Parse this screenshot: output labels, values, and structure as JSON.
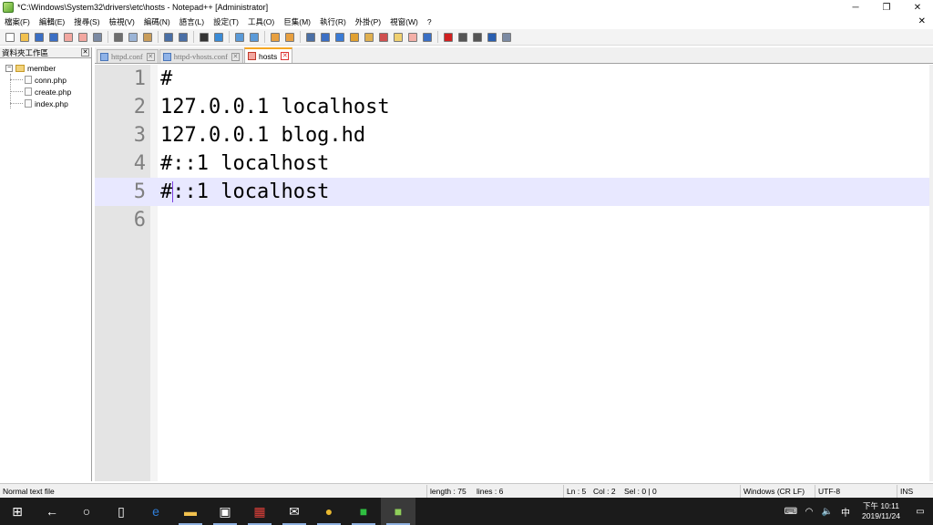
{
  "window": {
    "title": "*C:\\Windows\\System32\\drivers\\etc\\hosts - Notepad++ [Administrator]",
    "minimize": "─",
    "maximize": "❐",
    "close": "✕"
  },
  "menu": {
    "items": [
      "檔案(F)",
      "編輯(E)",
      "搜尋(S)",
      "檢視(V)",
      "編碼(N)",
      "語言(L)",
      "設定(T)",
      "工具(O)",
      "巨集(M)",
      "執行(R)",
      "外掛(P)",
      "視窗(W)",
      "?"
    ],
    "close": "✕"
  },
  "toolbar": {
    "icons": [
      {
        "name": "new-file-icon",
        "color": "#ffffff"
      },
      {
        "name": "open-file-icon",
        "color": "#f2c14e"
      },
      {
        "name": "save-icon",
        "color": "#3b6fc4"
      },
      {
        "name": "save-all-icon",
        "color": "#3b6fc4"
      },
      {
        "name": "close-icon",
        "color": "#f2a7a0"
      },
      {
        "name": "close-all-icon",
        "color": "#f2a7a0"
      },
      {
        "name": "print-icon",
        "color": "#7b8aa3"
      },
      {
        "name": "sep"
      },
      {
        "name": "cut-icon",
        "color": "#6e6e6e"
      },
      {
        "name": "copy-icon",
        "color": "#9bb4d6"
      },
      {
        "name": "paste-icon",
        "color": "#c99d5b"
      },
      {
        "name": "sep"
      },
      {
        "name": "undo-icon",
        "color": "#4a6fa5"
      },
      {
        "name": "redo-icon",
        "color": "#4a6fa5"
      },
      {
        "name": "sep"
      },
      {
        "name": "find-icon",
        "color": "#333333"
      },
      {
        "name": "replace-icon",
        "color": "#3a8bd6"
      },
      {
        "name": "sep"
      },
      {
        "name": "zoom-in-icon",
        "color": "#5a9ad8"
      },
      {
        "name": "zoom-out-icon",
        "color": "#5a9ad8"
      },
      {
        "name": "sep"
      },
      {
        "name": "sync-vertical-icon",
        "color": "#e8a040"
      },
      {
        "name": "sync-horizontal-icon",
        "color": "#e8a040"
      },
      {
        "name": "sep"
      },
      {
        "name": "word-wrap-icon",
        "color": "#4a6fa5"
      },
      {
        "name": "show-all-chars-icon",
        "color": "#3b6fc4"
      },
      {
        "name": "indent-guide-icon",
        "color": "#3a7bd5"
      },
      {
        "name": "udl-icon",
        "color": "#e0a030"
      },
      {
        "name": "doc-map-icon",
        "color": "#e0b050"
      },
      {
        "name": "function-list-icon",
        "color": "#d05050"
      },
      {
        "name": "folder-as-workspace-icon",
        "color": "#f0d070"
      },
      {
        "name": "doc-list-icon",
        "color": "#f4b0a8"
      },
      {
        "name": "monitoring-icon",
        "color": "#3a6fc4"
      },
      {
        "name": "sep"
      },
      {
        "name": "record-macro-icon",
        "color": "#d02020"
      },
      {
        "name": "stop-macro-icon",
        "color": "#555555"
      },
      {
        "name": "play-macro-icon",
        "color": "#555555"
      },
      {
        "name": "run-macro-multiple-icon",
        "color": "#2a5fb0"
      },
      {
        "name": "save-macro-icon",
        "color": "#7b8aa3"
      }
    ]
  },
  "folder_panel": {
    "title": "資料夾工作區",
    "close": "✕",
    "root": {
      "expander": "−",
      "name": "member"
    },
    "files": [
      "conn.php",
      "create.php",
      "index.php"
    ]
  },
  "tabs": [
    {
      "label": "httpd.conf",
      "close": "✕",
      "active": false
    },
    {
      "label": "httpd-vhosts.conf",
      "close": "✕",
      "active": false
    },
    {
      "label": "hosts",
      "close": "✕",
      "active": true
    }
  ],
  "editor": {
    "lines": [
      {
        "num": "1",
        "text": "#"
      },
      {
        "num": "2",
        "text": "127.0.0.1 localhost"
      },
      {
        "num": "3",
        "text": "127.0.0.1 blog.hd"
      },
      {
        "num": "4",
        "text": "#::1 localhost"
      },
      {
        "num": "5",
        "text": "#::1 localhost",
        "current": true
      },
      {
        "num": "6",
        "text": ""
      }
    ]
  },
  "status": {
    "file_type": "Normal text file",
    "length": "length : 75",
    "lines": "lines : 6",
    "ln": "Ln : 5",
    "col": "Col : 2",
    "sel": "Sel : 0 | 0",
    "eol": "Windows (CR LF)",
    "encoding": "UTF-8",
    "mode": "INS"
  },
  "taskbar": {
    "apps": [
      {
        "name": "start-icon",
        "glyph": "⊞"
      },
      {
        "name": "back-icon",
        "glyph": "←"
      },
      {
        "name": "search-icon",
        "glyph": "○"
      },
      {
        "name": "task-view-icon",
        "glyph": "▯"
      },
      {
        "name": "edge-icon",
        "glyph": "e",
        "color": "#2f7ed8"
      },
      {
        "name": "file-explorer-icon",
        "glyph": "▬",
        "color": "#f2c14e"
      },
      {
        "name": "store-icon",
        "glyph": "▣",
        "color": "#ffffff"
      },
      {
        "name": "gift-icon",
        "glyph": "▦",
        "color": "#e0403a"
      },
      {
        "name": "mail-icon",
        "glyph": "✉",
        "color": "#ffffff"
      },
      {
        "name": "chrome-icon",
        "glyph": "●",
        "color": "#e8b830"
      },
      {
        "name": "line-icon",
        "glyph": "■",
        "color": "#2fbf41"
      },
      {
        "name": "notepadpp-icon",
        "glyph": "■",
        "color": "#8fcf5a"
      }
    ],
    "tray": {
      "keyboard": "⌨",
      "wifi": "◠",
      "volume": "🔈",
      "ime": "中",
      "time": "下午 10:11",
      "date": "2019/11/24",
      "notification": "▭"
    }
  }
}
